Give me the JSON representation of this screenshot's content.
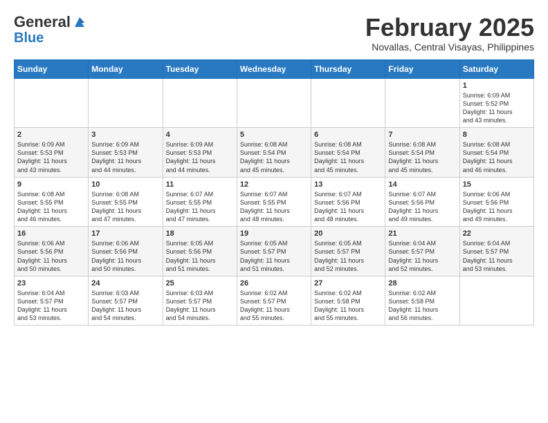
{
  "logo": {
    "general": "General",
    "blue": "Blue"
  },
  "header": {
    "month": "February 2025",
    "location": "Novallas, Central Visayas, Philippines"
  },
  "weekdays": [
    "Sunday",
    "Monday",
    "Tuesday",
    "Wednesday",
    "Thursday",
    "Friday",
    "Saturday"
  ],
  "weeks": [
    [
      {
        "day": "",
        "info": ""
      },
      {
        "day": "",
        "info": ""
      },
      {
        "day": "",
        "info": ""
      },
      {
        "day": "",
        "info": ""
      },
      {
        "day": "",
        "info": ""
      },
      {
        "day": "",
        "info": ""
      },
      {
        "day": "1",
        "info": "Sunrise: 6:09 AM\nSunset: 5:52 PM\nDaylight: 11 hours\nand 43 minutes."
      }
    ],
    [
      {
        "day": "2",
        "info": "Sunrise: 6:09 AM\nSunset: 5:53 PM\nDaylight: 11 hours\nand 43 minutes."
      },
      {
        "day": "3",
        "info": "Sunrise: 6:09 AM\nSunset: 5:53 PM\nDaylight: 11 hours\nand 44 minutes."
      },
      {
        "day": "4",
        "info": "Sunrise: 6:09 AM\nSunset: 5:53 PM\nDaylight: 11 hours\nand 44 minutes."
      },
      {
        "day": "5",
        "info": "Sunrise: 6:08 AM\nSunset: 5:54 PM\nDaylight: 11 hours\nand 45 minutes."
      },
      {
        "day": "6",
        "info": "Sunrise: 6:08 AM\nSunset: 5:54 PM\nDaylight: 11 hours\nand 45 minutes."
      },
      {
        "day": "7",
        "info": "Sunrise: 6:08 AM\nSunset: 5:54 PM\nDaylight: 11 hours\nand 45 minutes."
      },
      {
        "day": "8",
        "info": "Sunrise: 6:08 AM\nSunset: 5:54 PM\nDaylight: 11 hours\nand 46 minutes."
      }
    ],
    [
      {
        "day": "9",
        "info": "Sunrise: 6:08 AM\nSunset: 5:55 PM\nDaylight: 11 hours\nand 46 minutes."
      },
      {
        "day": "10",
        "info": "Sunrise: 6:08 AM\nSunset: 5:55 PM\nDaylight: 11 hours\nand 47 minutes."
      },
      {
        "day": "11",
        "info": "Sunrise: 6:07 AM\nSunset: 5:55 PM\nDaylight: 11 hours\nand 47 minutes."
      },
      {
        "day": "12",
        "info": "Sunrise: 6:07 AM\nSunset: 5:55 PM\nDaylight: 11 hours\nand 48 minutes."
      },
      {
        "day": "13",
        "info": "Sunrise: 6:07 AM\nSunset: 5:56 PM\nDaylight: 11 hours\nand 48 minutes."
      },
      {
        "day": "14",
        "info": "Sunrise: 6:07 AM\nSunset: 5:56 PM\nDaylight: 11 hours\nand 49 minutes."
      },
      {
        "day": "15",
        "info": "Sunrise: 6:06 AM\nSunset: 5:56 PM\nDaylight: 11 hours\nand 49 minutes."
      }
    ],
    [
      {
        "day": "16",
        "info": "Sunrise: 6:06 AM\nSunset: 5:56 PM\nDaylight: 11 hours\nand 50 minutes."
      },
      {
        "day": "17",
        "info": "Sunrise: 6:06 AM\nSunset: 5:56 PM\nDaylight: 11 hours\nand 50 minutes."
      },
      {
        "day": "18",
        "info": "Sunrise: 6:05 AM\nSunset: 5:56 PM\nDaylight: 11 hours\nand 51 minutes."
      },
      {
        "day": "19",
        "info": "Sunrise: 6:05 AM\nSunset: 5:57 PM\nDaylight: 11 hours\nand 51 minutes."
      },
      {
        "day": "20",
        "info": "Sunrise: 6:05 AM\nSunset: 5:57 PM\nDaylight: 11 hours\nand 52 minutes."
      },
      {
        "day": "21",
        "info": "Sunrise: 6:04 AM\nSunset: 5:57 PM\nDaylight: 11 hours\nand 52 minutes."
      },
      {
        "day": "22",
        "info": "Sunrise: 6:04 AM\nSunset: 5:57 PM\nDaylight: 11 hours\nand 53 minutes."
      }
    ],
    [
      {
        "day": "23",
        "info": "Sunrise: 6:04 AM\nSunset: 5:57 PM\nDaylight: 11 hours\nand 53 minutes."
      },
      {
        "day": "24",
        "info": "Sunrise: 6:03 AM\nSunset: 5:57 PM\nDaylight: 11 hours\nand 54 minutes."
      },
      {
        "day": "25",
        "info": "Sunrise: 6:03 AM\nSunset: 5:57 PM\nDaylight: 11 hours\nand 54 minutes."
      },
      {
        "day": "26",
        "info": "Sunrise: 6:02 AM\nSunset: 5:57 PM\nDaylight: 11 hours\nand 55 minutes."
      },
      {
        "day": "27",
        "info": "Sunrise: 6:02 AM\nSunset: 5:58 PM\nDaylight: 11 hours\nand 55 minutes."
      },
      {
        "day": "28",
        "info": "Sunrise: 6:02 AM\nSunset: 5:58 PM\nDaylight: 11 hours\nand 56 minutes."
      },
      {
        "day": "",
        "info": ""
      }
    ]
  ]
}
